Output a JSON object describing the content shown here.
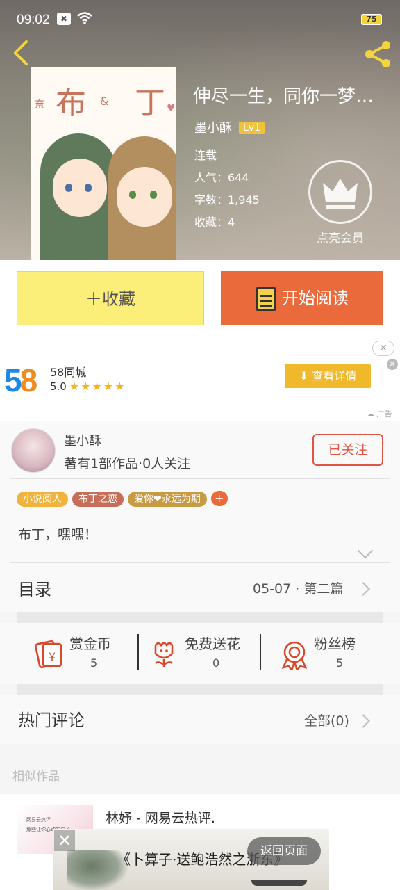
{
  "status_bar": {
    "time": "09:02",
    "battery": "75"
  },
  "book": {
    "cover": {
      "title_chars": [
        "布",
        "丁"
      ],
      "amp": "&",
      "side_text": "奈",
      "heart": "♥"
    },
    "title": "伸尽一生，同你一梦…",
    "author": "墨小酥",
    "level": "Lv1",
    "status": "连载",
    "popularity_label": "人气：644",
    "word_count_label": "字数：1,945",
    "favorites_label": "收藏：4",
    "vip_label": "点亮会员"
  },
  "actions": {
    "collect_label": "＋收藏",
    "read_label": "开始阅读"
  },
  "ad": {
    "logo": "58",
    "name": "58同城",
    "rating": "5.0",
    "stars": "★★★★★",
    "detail_button": "查看详情",
    "ad_tag": "☁ 广告",
    "close": "✕"
  },
  "author_section": {
    "name": "墨小酥",
    "info": "著有1部作品·0人关注",
    "follow_label": "已关注",
    "tags": [
      {
        "label": "小说阅人",
        "color": "#f0b43c"
      },
      {
        "label": "布丁之恋",
        "color": "#c76e58"
      },
      {
        "label": "爱你❤永远为期",
        "color": "#c79a44"
      }
    ],
    "add_tag": "+",
    "intro": "布丁，嘿嘿！"
  },
  "catalog": {
    "label": "目录",
    "latest": "05-07 · 第二篇"
  },
  "stats": [
    {
      "label": "赏金币",
      "value": "5"
    },
    {
      "label": "免费送花",
      "value": "0"
    },
    {
      "label": "粉丝榜",
      "value": "5"
    }
  ],
  "hot_comments": {
    "label": "热门评论",
    "all": "全部(0)"
  },
  "similar": {
    "label": "相似作品",
    "first_title": "林妤 - 网易云热评.",
    "thumb_line1": "网易云热评",
    "thumb_line2": "那些让你心动的句子"
  },
  "banner_ad": {
    "poem": "《卜算子·送鲍浩然之浙东》",
    "close": "✕",
    "return_label": "返回页面"
  },
  "colors": {
    "accent": "#ea6a3c",
    "collect_bg": "#fbef7a",
    "follow": "#e05545",
    "level_badge": "#f0c33c"
  }
}
